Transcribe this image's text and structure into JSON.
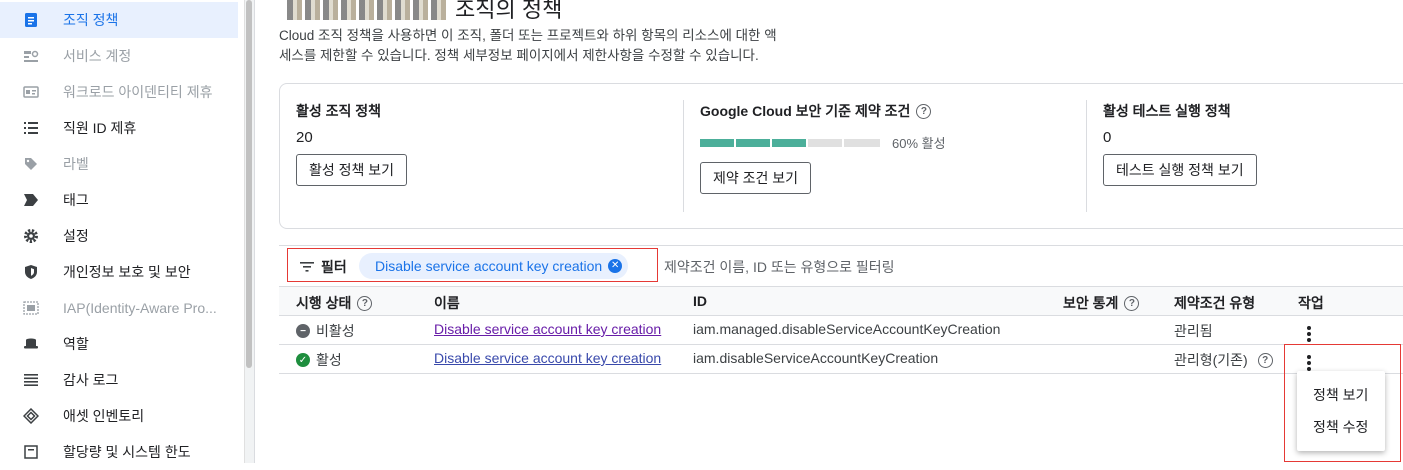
{
  "sidebar": {
    "items": [
      {
        "label": "조직 정책",
        "icon": "policy-doc-icon",
        "state": "active"
      },
      {
        "label": "서비스 계정",
        "icon": "service-account-icon",
        "state": "disabled"
      },
      {
        "label": "워크로드 아이덴티티 제휴",
        "icon": "id-card-icon",
        "state": "disabled"
      },
      {
        "label": "직원 ID 제휴",
        "icon": "list-icon",
        "state": "normal"
      },
      {
        "label": "라벨",
        "icon": "label-tag-icon",
        "state": "disabled"
      },
      {
        "label": "태그",
        "icon": "tag-arrow-icon",
        "state": "normal"
      },
      {
        "label": "설정",
        "icon": "gear-icon",
        "state": "normal"
      },
      {
        "label": "개인정보 보호 및 보안",
        "icon": "shield-icon",
        "state": "normal"
      },
      {
        "label": "IAP(Identity-Aware Pro...",
        "icon": "iap-icon",
        "state": "disabled"
      },
      {
        "label": "역할",
        "icon": "hat-icon",
        "state": "normal"
      },
      {
        "label": "감사 로그",
        "icon": "lines-icon",
        "state": "normal"
      },
      {
        "label": "애셋 인벤토리",
        "icon": "diamond-icon",
        "state": "normal"
      },
      {
        "label": "할당량 및 시스템 한도",
        "icon": "quota-icon",
        "state": "normal"
      }
    ]
  },
  "header": {
    "title": "조직의 정책",
    "description_line1": "Cloud 조직 정책을 사용하면 이 조직, 폴더 또는 프로젝트와 하위 항목의 리소스에 대한 액",
    "description_line2": "세스를 제한할 수 있습니다. 정책 세부정보 페이지에서 제한사항을 수정할 수 있습니다."
  },
  "summary": {
    "active": {
      "title": "활성 조직 정책",
      "count": "20",
      "button": "활성 정책 보기"
    },
    "baseline": {
      "title": "Google Cloud 보안 기준 제약 조건",
      "progress": 0.6,
      "progress_label": "60% 활성",
      "button": "제약 조건 보기"
    },
    "dryrun": {
      "title": "활성 테스트 실행 정책",
      "count": "0",
      "button": "테스트 실행 정책 보기"
    }
  },
  "filter": {
    "label": "필터",
    "chip": "Disable service account key creation",
    "placeholder": "제약조건 이름, ID 또는 유형으로 필터링"
  },
  "table": {
    "columns": {
      "status": "시행 상태",
      "name": "이름",
      "id": "ID",
      "security": "보안 통계",
      "type": "제약조건 유형",
      "action": "작업"
    },
    "rows": [
      {
        "status": "비활성",
        "name": "Disable service account key creation",
        "id": "iam.managed.disableServiceAccountKeyCreation",
        "type": "관리됨"
      },
      {
        "status": "활성",
        "name": "Disable service account key creation",
        "id": "iam.disableServiceAccountKeyCreation",
        "type": "관리형(기존)"
      }
    ]
  },
  "menu": {
    "view": "정책 보기",
    "edit": "정책 수정"
  },
  "colors": {
    "accent": "#1a73e8",
    "active_bg": "#e8f0fe",
    "progress": "#4caf9a",
    "highlight": "#e53935",
    "success": "#1e8e3e"
  }
}
